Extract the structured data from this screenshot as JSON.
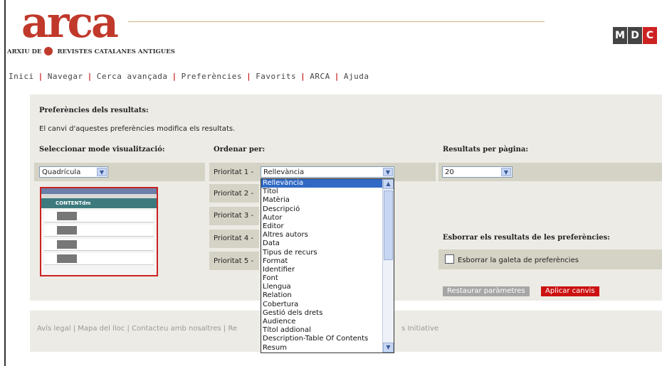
{
  "logo": {
    "word": "arca",
    "sub_left": "ARXIU DE",
    "sub_right": "REVISTES CATALANES ANTIGUES",
    "partner": [
      "M",
      "D",
      "C"
    ]
  },
  "nav": [
    "Inici",
    "Navegar",
    "Cerca avançada",
    "Preferències",
    "Favorits",
    "ARCA",
    "Ajuda"
  ],
  "panel": {
    "title": "Preferències dels resultats:",
    "description": "El canvi d'aquestes preferències modifica els resultats.",
    "view_label": "Seleccionar mode visualització:",
    "view_value": "Quadrícula",
    "order_label": "Ordenar per:",
    "priorities": [
      "Prioritat 1 -",
      "Prioritat 2 -",
      "Prioritat 3 -",
      "Prioritat 4 -",
      "Prioritat 5 -"
    ],
    "priority1_value": "Rellevància",
    "results_label": "Resultats per pàgina:",
    "results_value": "20",
    "clear_label": "Esborrar els resultats de les preferències:",
    "clear_checkbox": "Esborrar la galeta de preferències",
    "restore_button": "Restaurar paràmetres",
    "apply_button": "Aplicar canvis",
    "thumb_header": "CONTENTdm"
  },
  "dropdown_options": [
    "Rellevància",
    "Títol",
    "Matèria",
    "Descripció",
    "Autor",
    "Editor",
    "Altres autors",
    "Data",
    "Tipus de recurs",
    "Format",
    "Identifier",
    "Font",
    "Llengua",
    "Relation",
    "Cobertura",
    "Gestió dels drets",
    "Audience",
    "Títol addional",
    "Description-Table Of Contents",
    "Resum"
  ],
  "footer": {
    "left": "Avís legal | Mapa del lloc | Contacteu amb nosaltres | Re",
    "right": "s Initiative"
  },
  "colors": {
    "accent": "#cc2222",
    "panel": "#ecebe5",
    "band": "#d5d3c5",
    "selection": "#316ac5"
  }
}
